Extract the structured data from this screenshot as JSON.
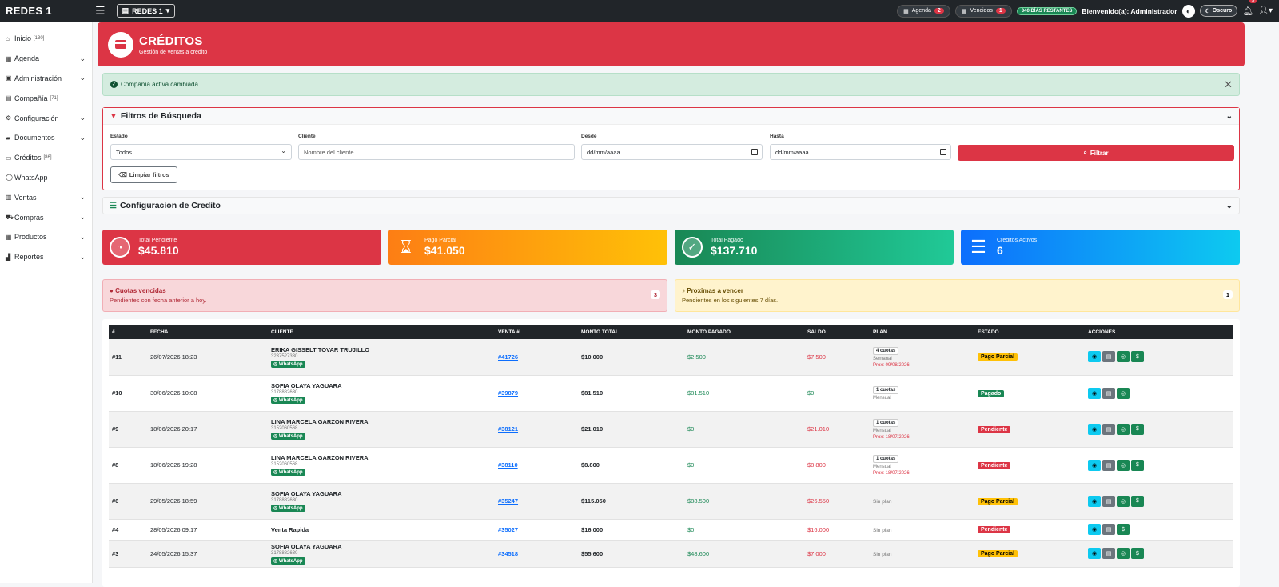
{
  "topbar": {
    "brand": "REDES 1",
    "company": "REDES 1",
    "agenda_label": "Agenda",
    "agenda_count": "2",
    "vencidos_label": "Vencidos",
    "vencidos_count": "1",
    "days_left": "340 DÍAS RESTANTES",
    "welcome_prefix": "Bienvenido(a):",
    "welcome_user": "Administrador",
    "theme_label": "Oscuro",
    "notif_count": "3"
  },
  "sidebar": {
    "items": [
      {
        "label": "Inicio",
        "count": "[130]"
      },
      {
        "label": "Agenda"
      },
      {
        "label": "Administración"
      },
      {
        "label": "Compañía",
        "count": "[71]"
      },
      {
        "label": "Configuración"
      },
      {
        "label": "Documentos"
      },
      {
        "label": "Créditos",
        "count": "[86]"
      },
      {
        "label": "WhatsApp"
      },
      {
        "label": "Ventas"
      },
      {
        "label": "Compras"
      },
      {
        "label": "Productos"
      },
      {
        "label": "Reportes"
      }
    ]
  },
  "hero": {
    "title": "CRÉDITOS",
    "subtitle": "Gestión de ventas a crédito"
  },
  "alert": {
    "text": "Compañía activa cambiada."
  },
  "filters": {
    "title": "Filtros de Búsqueda",
    "estado_label": "Estado",
    "estado_value": "Todos",
    "cliente_label": "Cliente",
    "cliente_placeholder": "Nombre del cliente...",
    "desde_label": "Desde",
    "desde_value": "dd/mm/aaaa",
    "hasta_label": "Hasta",
    "hasta_value": "dd/mm/aaaa",
    "filter_button": "Filtrar",
    "clear_button": "Limpiar filtros"
  },
  "config": {
    "title": "Configuracion de Credito"
  },
  "stats": [
    {
      "label": "Total Pendiente",
      "value": "$45.810",
      "color": "#dc3545"
    },
    {
      "label": "Pago Parcial",
      "value": "$41.050",
      "color": "#fd7e14"
    },
    {
      "label": "Total Pagado",
      "value": "$137.710",
      "color": "#198754"
    },
    {
      "label": "Créditos Activos",
      "value": "6",
      "color": "#0d6efd"
    }
  ],
  "overdue": {
    "title": "Cuotas vencidas",
    "subtitle": "Pendientes con fecha anterior a hoy.",
    "count": "3"
  },
  "upcoming": {
    "title": "Proximas a vencer",
    "subtitle": "Pendientes en los siguientes 7 días.",
    "count": "1"
  },
  "table": {
    "headers": [
      "#",
      "FECHA",
      "CLIENTE",
      "VENTA #",
      "MONTO TOTAL",
      "MONTO PAGADO",
      "SALDO",
      "PLAN",
      "ESTADO",
      "ACCIONES"
    ],
    "whatsapp_label": "WhatsApp",
    "rows": [
      {
        "id": "#11",
        "date": "26/07/2026 18:23",
        "client": "ERIKA GISSELT TOVAR TRUJILLO",
        "phone": "3237527330",
        "wa": true,
        "sale": "#41726",
        "total": "$10.000",
        "paid": "$2.500",
        "balance": "$7.500",
        "balance_red": true,
        "plan": "4 cuotas",
        "freq": "Semanal",
        "next": "Prox: 09/08/2026",
        "status": "Pago Parcial",
        "status_type": "warn",
        "actions": [
          "view",
          "print",
          "wa",
          "pay"
        ]
      },
      {
        "id": "#10",
        "date": "30/06/2026 10:08",
        "client": "SOFIA OLAYA YAGUARA",
        "phone": "3178882630",
        "wa": true,
        "sale": "#39879",
        "total": "$81.510",
        "paid": "$81.510",
        "balance": "$0",
        "balance_red": false,
        "plan": "1 cuotas",
        "freq": "Mensual",
        "next": "",
        "status": "Pagado",
        "status_type": "ok",
        "actions": [
          "view",
          "print",
          "wa"
        ]
      },
      {
        "id": "#9",
        "date": "18/06/2026 20:17",
        "client": "LINA MARCELA GARZON RIVERA",
        "phone": "3152060568",
        "wa": true,
        "sale": "#38121",
        "total": "$21.010",
        "paid": "$0",
        "balance": "$21.010",
        "balance_red": true,
        "plan": "1 cuotas",
        "freq": "Mensual",
        "next": "Prox: 18/07/2026",
        "status": "Pendiente",
        "status_type": "bad",
        "actions": [
          "view",
          "print",
          "wa",
          "pay"
        ]
      },
      {
        "id": "#8",
        "date": "18/06/2026 19:28",
        "client": "LINA MARCELA GARZON RIVERA",
        "phone": "3152060568",
        "wa": true,
        "sale": "#38110",
        "total": "$8.800",
        "paid": "$0",
        "balance": "$8.800",
        "balance_red": true,
        "plan": "1 cuotas",
        "freq": "Mensual",
        "next": "Prox: 18/07/2026",
        "status": "Pendiente",
        "status_type": "bad",
        "actions": [
          "view",
          "print",
          "wa",
          "pay"
        ]
      },
      {
        "id": "#6",
        "date": "29/05/2026 18:59",
        "client": "SOFIA OLAYA YAGUARA",
        "phone": "3178882630",
        "wa": true,
        "sale": "#35247",
        "total": "$115.050",
        "paid": "$88.500",
        "balance": "$26.550",
        "balance_red": true,
        "plan": "",
        "noplan": "Sin plan",
        "status": "Pago Parcial",
        "status_type": "warn",
        "actions": [
          "view",
          "print",
          "wa",
          "pay"
        ]
      },
      {
        "id": "#4",
        "date": "28/05/2026 09:17",
        "client": "Venta Rapida",
        "phone": "",
        "wa": false,
        "sale": "#35027",
        "total": "$16.000",
        "paid": "$0",
        "balance": "$16.000",
        "balance_red": true,
        "plan": "",
        "noplan": "Sin plan",
        "status": "Pendiente",
        "status_type": "bad",
        "actions": [
          "view",
          "print",
          "pay"
        ]
      },
      {
        "id": "#3",
        "date": "24/05/2026 15:37",
        "client": "SOFIA OLAYA YAGUARA",
        "phone": "3178882630",
        "wa": true,
        "sale": "#34518",
        "total": "$55.600",
        "paid": "$48.600",
        "balance": "$7.000",
        "balance_red": true,
        "plan": "",
        "noplan": "Sin plan",
        "status": "Pago Parcial",
        "status_type": "warn",
        "actions": [
          "view",
          "print",
          "wa",
          "pay"
        ]
      }
    ]
  }
}
